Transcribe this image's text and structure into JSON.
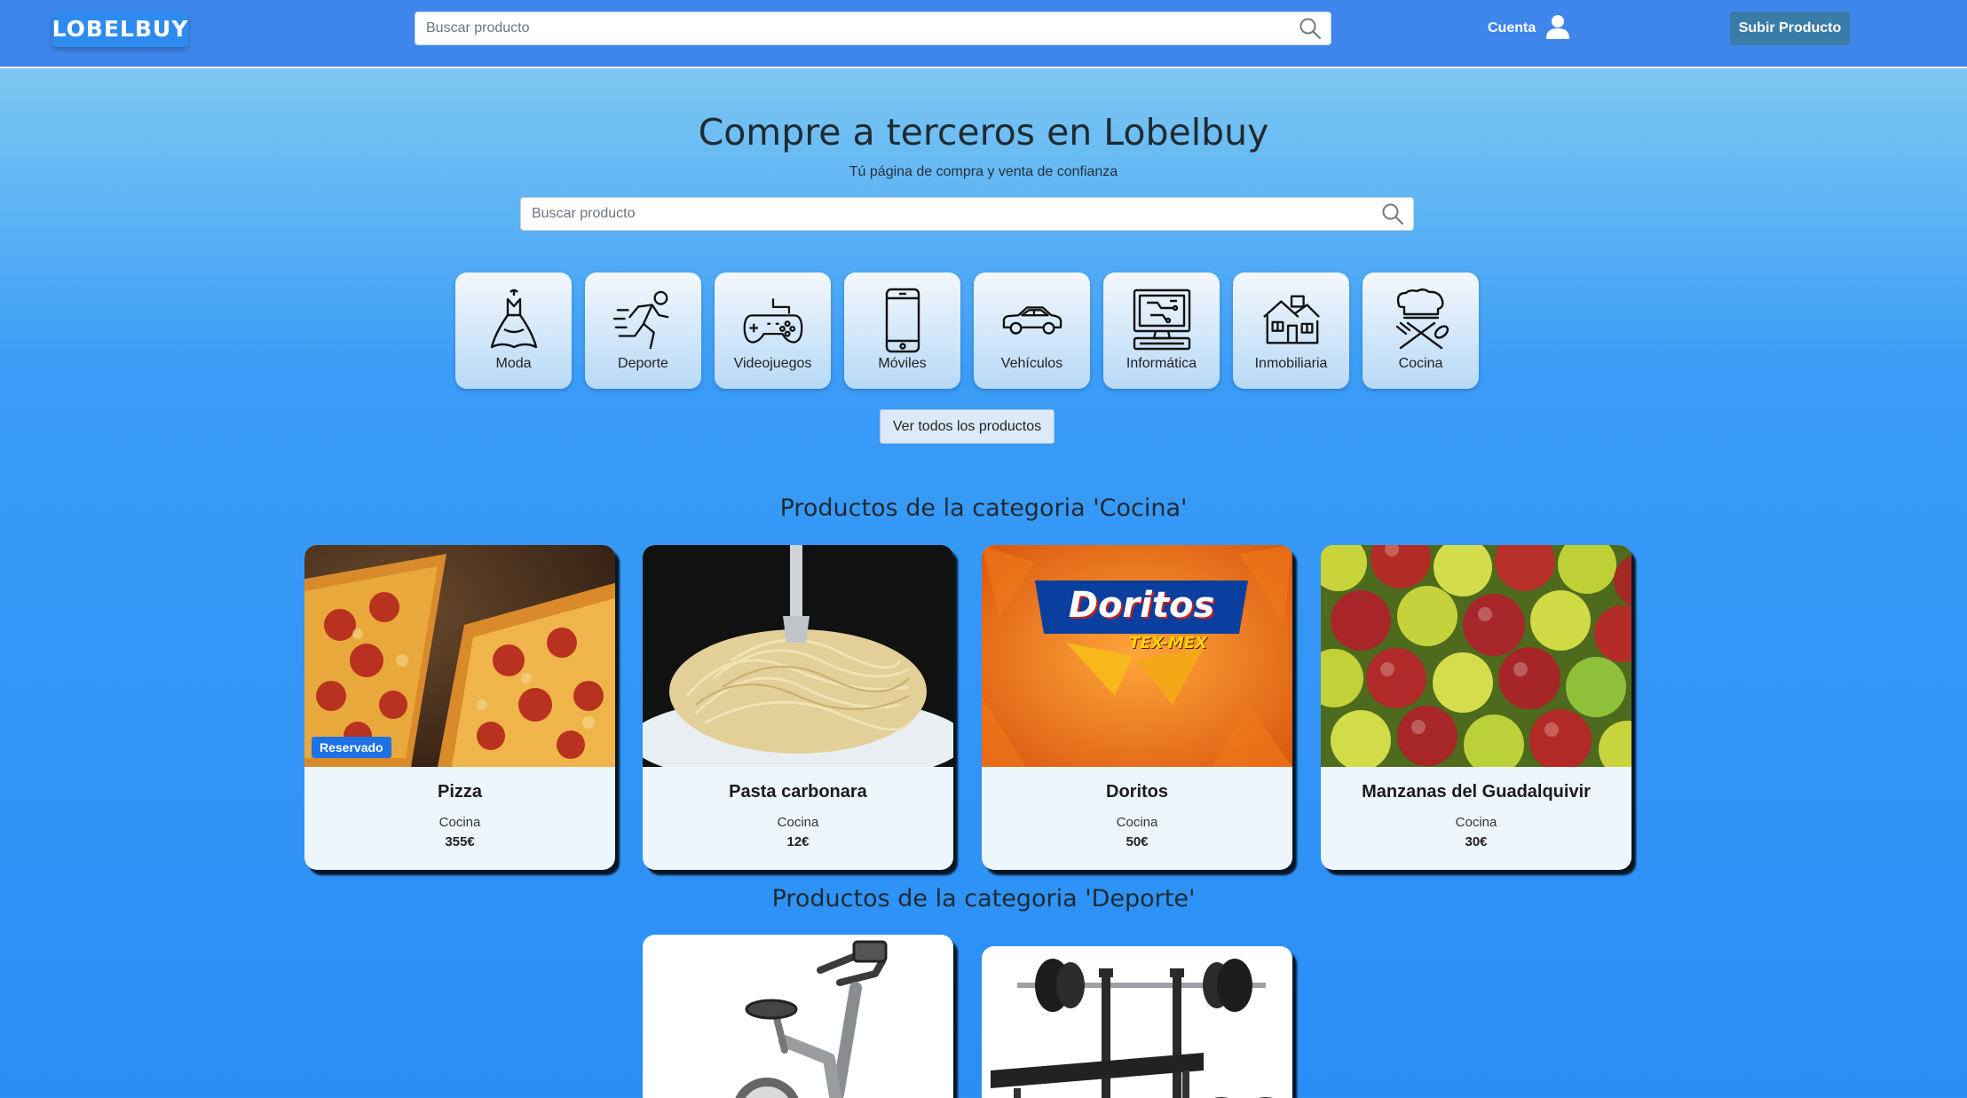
{
  "navbar": {
    "logo": "LOBELBUY",
    "search_placeholder": "Buscar producto",
    "account_label": "Cuenta",
    "upload_label": "Subir Producto"
  },
  "hero": {
    "title": "Compre a terceros en Lobelbuy",
    "subtitle": "Tú página de compra y venta de confianza",
    "search_placeholder": "Buscar producto"
  },
  "categories": [
    {
      "label": "Moda",
      "icon": "dress-icon"
    },
    {
      "label": "Deporte",
      "icon": "runner-icon"
    },
    {
      "label": "Videojuegos",
      "icon": "gamepad-icon"
    },
    {
      "label": "Móviles",
      "icon": "smartphone-icon"
    },
    {
      "label": "Vehículos",
      "icon": "car-icon"
    },
    {
      "label": "Informática",
      "icon": "computer-icon"
    },
    {
      "label": "Inmobiliaria",
      "icon": "house-icon"
    },
    {
      "label": "Cocina",
      "icon": "cooking-icon"
    }
  ],
  "all_products_label": "Ver todos los productos",
  "sections": [
    {
      "title": "Productos de la categoria 'Cocina'",
      "products": [
        {
          "name": "Pizza",
          "category": "Cocina",
          "price": "355€",
          "badge": "Reservado",
          "image": "pizza-image"
        },
        {
          "name": "Pasta carbonara",
          "category": "Cocina",
          "price": "12€",
          "image": "pasta-image"
        },
        {
          "name": "Doritos",
          "category": "Cocina",
          "price": "50€",
          "image": "doritos-image",
          "image_text": "Doritos",
          "image_subtext": "TEX-MEX"
        },
        {
          "name": "Manzanas del Guadalquivir",
          "category": "Cocina",
          "price": "30€",
          "image": "apples-image"
        }
      ]
    },
    {
      "title": "Productos de la categoria 'Deporte'",
      "products": [
        {
          "image": "exercise-bike-image"
        },
        {
          "image": "weight-bench-image"
        }
      ]
    }
  ],
  "colors": {
    "navbar": "#3f86ec",
    "logo_bg": "#2e8bf0",
    "upload_btn": "#3a7ca8",
    "badge": "#1f71e6"
  }
}
